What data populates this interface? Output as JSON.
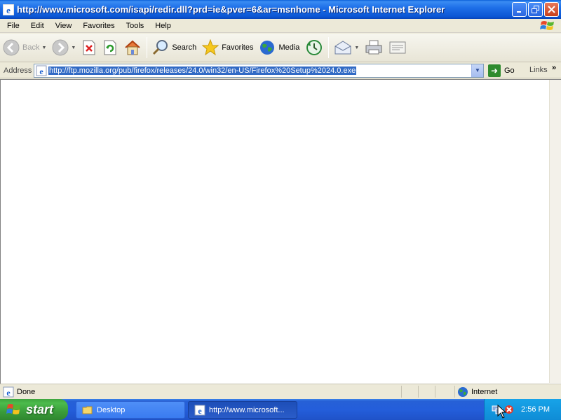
{
  "window": {
    "title": "http://www.microsoft.com/isapi/redir.dll?prd=ie&pver=6&ar=msnhome - Microsoft Internet Explorer"
  },
  "menu": {
    "items": [
      {
        "label": "File"
      },
      {
        "label": "Edit"
      },
      {
        "label": "View"
      },
      {
        "label": "Favorites"
      },
      {
        "label": "Tools"
      },
      {
        "label": "Help"
      }
    ]
  },
  "toolbar": {
    "back_label": "Back",
    "search_label": "Search",
    "favorites_label": "Favorites",
    "media_label": "Media"
  },
  "address": {
    "label": "Address",
    "value": "http://ftp.mozilla.org/pub/firefox/releases/24.0/win32/en-US/Firefox%20Setup%2024.0.exe",
    "go_label": "Go",
    "links_label": "Links"
  },
  "status": {
    "text": "Done",
    "zone": "Internet"
  },
  "taskbar": {
    "start_label": "start",
    "tasks": [
      {
        "label": "Desktop"
      },
      {
        "label": "http://www.microsoft..."
      }
    ],
    "clock": "2:56 PM"
  },
  "colors": {
    "titlebar": "#0b56d4",
    "selection": "#316ac5",
    "taskbar": "#245edb",
    "start": "#3a9d3a",
    "tray": "#0f8cd6"
  }
}
